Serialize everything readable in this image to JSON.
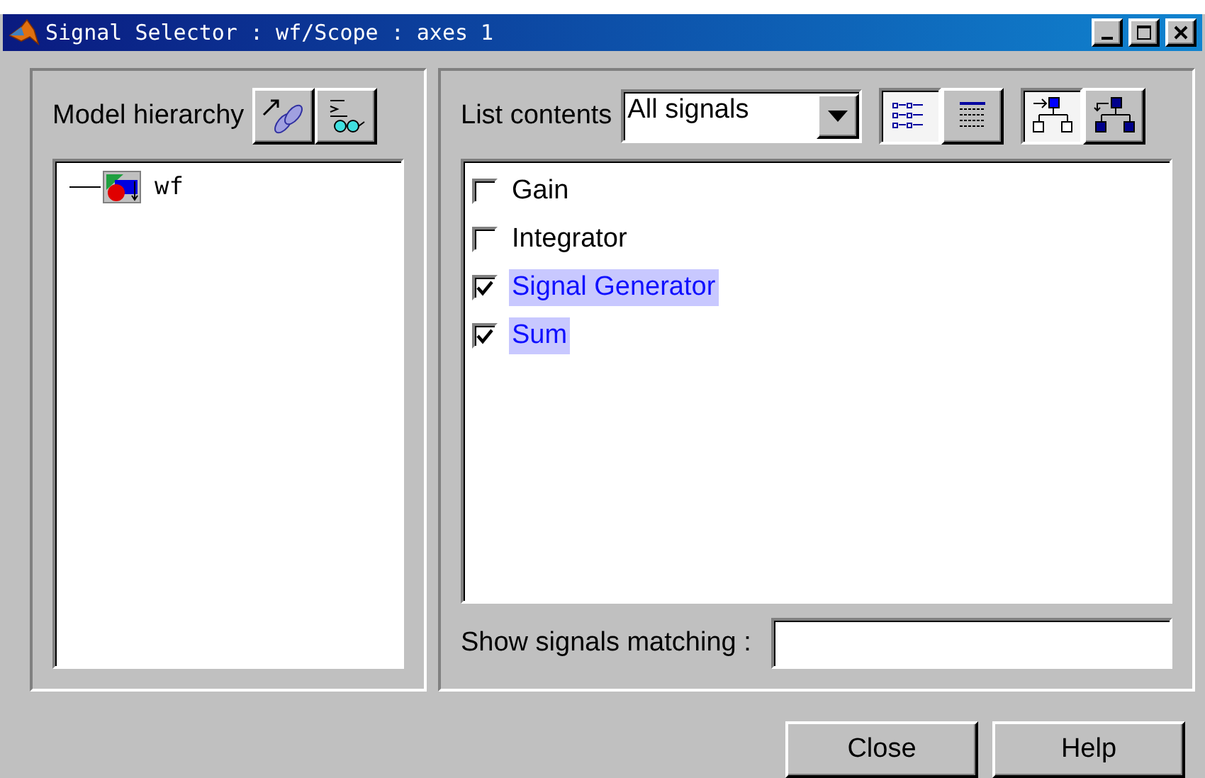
{
  "window": {
    "title": "Signal Selector : wf/Scope : axes 1"
  },
  "hierarchy": {
    "label": "Model hierarchy",
    "tools": [
      {
        "kind": "link"
      },
      {
        "kind": "find"
      }
    ],
    "tree": [
      {
        "label": "wf"
      }
    ]
  },
  "list_contents": {
    "label": "List contents",
    "dropdown": "All signals",
    "view_buttons": [
      {
        "kind": "list",
        "selected": true
      },
      {
        "kind": "detail",
        "selected": false
      }
    ],
    "scope_buttons": [
      {
        "kind": "current",
        "selected": true
      },
      {
        "kind": "all",
        "selected": false
      }
    ]
  },
  "signals": [
    {
      "name": "Gain",
      "checked": false
    },
    {
      "name": "Integrator",
      "checked": false
    },
    {
      "name": "Signal Generator",
      "checked": true
    },
    {
      "name": "Sum",
      "checked": true
    }
  ],
  "filter": {
    "label": "Show signals matching :"
  },
  "buttons": [
    "Close",
    "Help"
  ]
}
